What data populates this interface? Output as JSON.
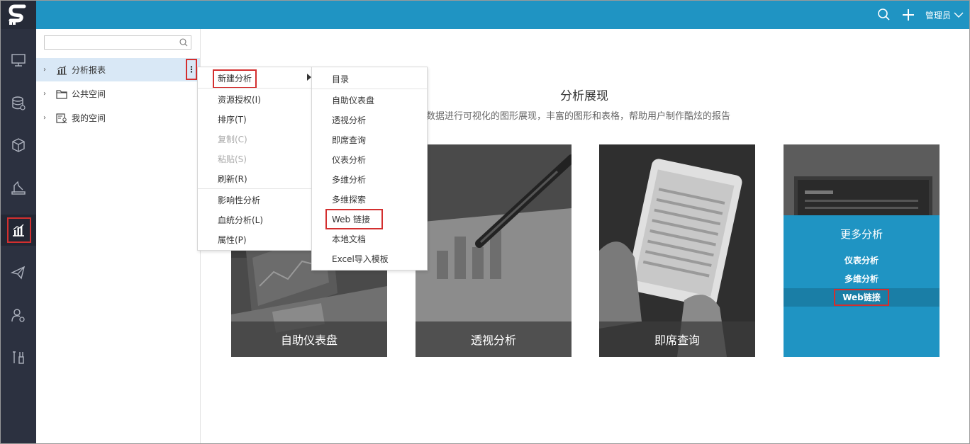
{
  "topbar": {
    "admin_label": "管理员",
    "icons": [
      "search-icon",
      "plus-icon",
      "chevron-down-icon"
    ]
  },
  "rail": {
    "items": [
      "monitor-icon",
      "database-icon",
      "cube-icon",
      "pen-ruler-icon",
      "analysis-report-icon",
      "paper-plane-icon",
      "user-settings-icon",
      "tools-icon"
    ],
    "active_index": 4
  },
  "tree": {
    "search_placeholder": "",
    "nodes": [
      {
        "label": "分析报表",
        "icon": "chart-icon",
        "selected": true
      },
      {
        "label": "公共空间",
        "icon": "folder-icon",
        "selected": false
      },
      {
        "label": "我的空间",
        "icon": "user-folder-icon",
        "selected": false
      }
    ]
  },
  "context_menu": {
    "items": [
      {
        "label": "新建分析",
        "has_submenu": true
      },
      {
        "label": "资源授权(I)"
      },
      {
        "label": "排序(T)"
      },
      {
        "label": "复制(C)",
        "disabled": true
      },
      {
        "label": "粘贴(S)",
        "disabled": true
      },
      {
        "label": "刷新(R)"
      },
      {
        "label": "影响性分析"
      },
      {
        "label": "血统分析(L)"
      },
      {
        "label": "属性(P)"
      }
    ]
  },
  "submenu": {
    "items": [
      {
        "label": "目录"
      },
      {
        "label": "自助仪表盘"
      },
      {
        "label": "透视分析"
      },
      {
        "label": "即席查询"
      },
      {
        "label": "仪表分析"
      },
      {
        "label": "多维分析"
      },
      {
        "label": "多维探索"
      },
      {
        "label": "Web 链接"
      },
      {
        "label": "本地文档"
      },
      {
        "label": "Excel导入模板"
      }
    ]
  },
  "main": {
    "title": "分析展现",
    "subtitle": "数据进行可视化的图形展现，丰富的图形和表格，帮助用户制作酷炫的报告",
    "cards": [
      {
        "caption": "自助仪表盘"
      },
      {
        "caption": "透视分析"
      },
      {
        "caption": "即席查询"
      }
    ],
    "more": {
      "title": "更多分析",
      "links": [
        "仪表分析",
        "多维分析",
        "Web链接"
      ]
    }
  },
  "colors": {
    "topbar": "#1f94c3",
    "rail": "#2c3140",
    "highlight_red": "#d32f2f",
    "selected_row": "#d9e8f6"
  }
}
